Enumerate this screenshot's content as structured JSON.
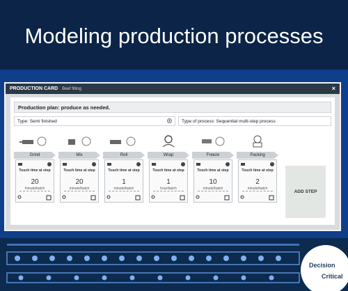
{
  "headline": "Modeling production processes",
  "window": {
    "title": "PRODUCTION CARD",
    "subtitle": "Beef filling",
    "close": "×"
  },
  "plan": "Production plan: produce as needed.",
  "type_semi": "Type: Semi finished",
  "type_process": "Type of process: Sequential multi-step process",
  "steps": [
    {
      "name": "Grind",
      "touch_label": "Touch time at step",
      "value": "20",
      "unit": "minute/batch"
    },
    {
      "name": "Mix",
      "touch_label": "Touch time at step",
      "value": "20",
      "unit": "minute/batch"
    },
    {
      "name": "Roll",
      "touch_label": "Touch time at step",
      "value": "1",
      "unit": "minute/batch"
    },
    {
      "name": "Wrap",
      "touch_label": "Touch time at step",
      "value": "1",
      "unit": "hour/batch"
    },
    {
      "name": "Freeze",
      "touch_label": "Touch time at step",
      "value": "10",
      "unit": "minute/batch"
    },
    {
      "name": "Packing",
      "touch_label": "Touch time at step",
      "value": "2",
      "unit": "minute/batch"
    }
  ],
  "add_step": "ADD STEP",
  "logo": {
    "line1": "Decision",
    "line2": "Critical"
  },
  "colors": {
    "header": "#0b2447",
    "band": "#0f3e8a",
    "titlebar": "#2b3946"
  }
}
